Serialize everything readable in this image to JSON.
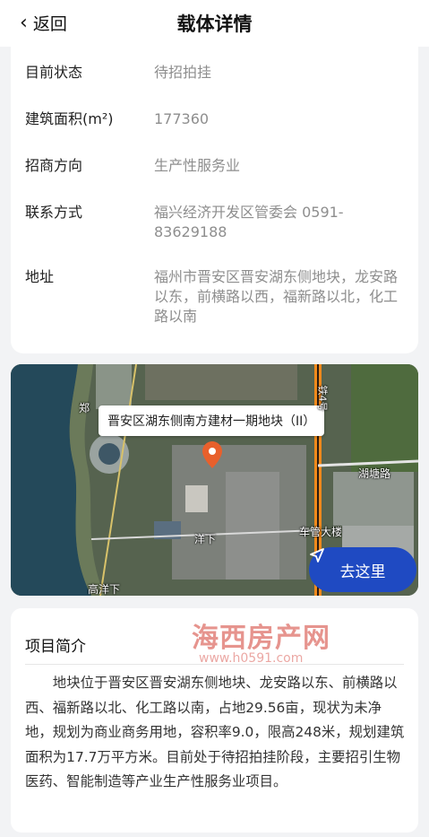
{
  "nav": {
    "back_label": "返回",
    "title": "载体详情"
  },
  "info": [
    {
      "label": "目前状态",
      "value": "待招拍挂"
    },
    {
      "label": "建筑面积(m²)",
      "value": "177360"
    },
    {
      "label": "招商方向",
      "value": "生产性服务业"
    },
    {
      "label": "联系方式",
      "value": "福兴经济开发区管委会 0591-83629188"
    },
    {
      "label": "地址",
      "value": "福州市晋安区晋安湖东侧地块，龙安路以东，前横路以西，福新路以北，化工路以南"
    }
  ],
  "map": {
    "marker_label": "晋安区湖东侧南方建材一期地块（II）",
    "places": [
      "郑",
      "湖塘路",
      "洋下",
      "车管大楼",
      "高洋下",
      "铁4号"
    ],
    "go_button": "去这里"
  },
  "intro": {
    "heading": "项目简介",
    "body": "地块位于晋安区晋安湖东侧地块、龙安路以东、前横路以西、福新路以北、化工路以南，占地29.56亩，现状为未净地，规划为商业商务用地，容积率9.0，限高248米，规划建筑面积为17.7万平方米。目前处于待招拍挂阶段，主要招引生物医药、智能制造等产业生产性服务业项目。"
  },
  "watermark": {
    "title": "海西房产网",
    "url": "www.h0591.com"
  },
  "colors": {
    "accent": "#1f4ac2",
    "marker": "#e8602c"
  }
}
